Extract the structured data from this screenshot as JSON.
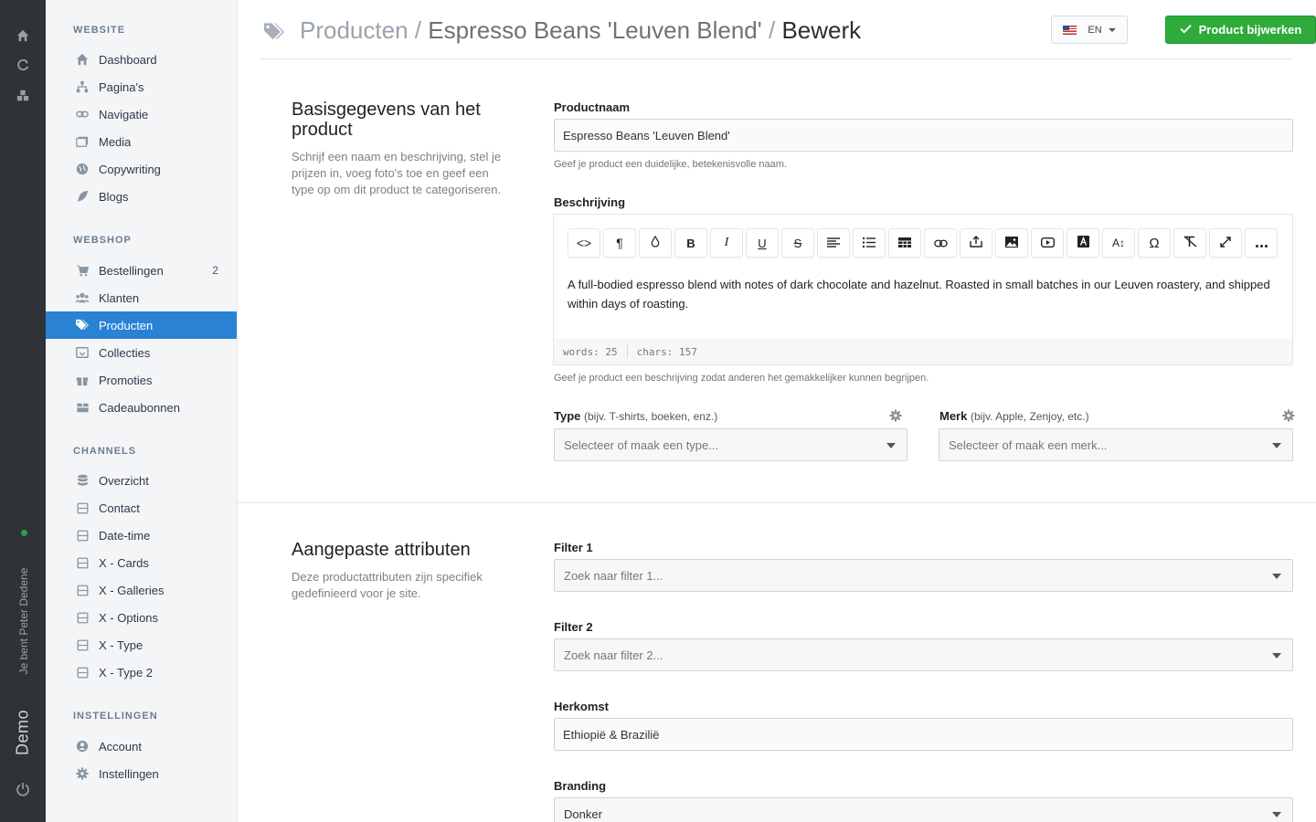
{
  "rail": {
    "user_text": "Je bent Peter Dedene",
    "brand": "Demo",
    "status_color": "#2e9e4f"
  },
  "sidebar": {
    "sections": [
      {
        "title": "WEBSITE",
        "items": [
          {
            "label": "Dashboard",
            "icon": "home-icon"
          },
          {
            "label": "Pagina's",
            "icon": "sitemap-icon"
          },
          {
            "label": "Navigatie",
            "icon": "link-icon"
          },
          {
            "label": "Media",
            "icon": "images-icon"
          },
          {
            "label": "Copywriting",
            "icon": "globe-icon"
          },
          {
            "label": "Blogs",
            "icon": "feather-icon"
          }
        ]
      },
      {
        "title": "WEBSHOP",
        "items": [
          {
            "label": "Bestellingen",
            "icon": "cart-icon",
            "badge": "2"
          },
          {
            "label": "Klanten",
            "icon": "users-icon"
          },
          {
            "label": "Producten",
            "icon": "tags-icon",
            "active": true
          },
          {
            "label": "Collecties",
            "icon": "archive-icon"
          },
          {
            "label": "Promoties",
            "icon": "gift-icon"
          },
          {
            "label": "Cadeaubonnen",
            "icon": "gift-card-icon"
          }
        ]
      },
      {
        "title": "CHANNELS",
        "items": [
          {
            "label": "Overzicht",
            "icon": "database-icon"
          },
          {
            "label": "Contact",
            "icon": "box-icon"
          },
          {
            "label": "Date-time",
            "icon": "box-icon"
          },
          {
            "label": "X - Cards",
            "icon": "box-icon"
          },
          {
            "label": "X - Galleries",
            "icon": "box-icon"
          },
          {
            "label": "X - Options",
            "icon": "box-icon"
          },
          {
            "label": "X - Type",
            "icon": "box-icon"
          },
          {
            "label": "X - Type 2",
            "icon": "box-icon"
          }
        ]
      },
      {
        "title": "INSTELLINGEN",
        "items": [
          {
            "label": "Account",
            "icon": "user-circle-icon"
          },
          {
            "label": "Instellingen",
            "icon": "gear-icon"
          }
        ]
      }
    ]
  },
  "header": {
    "crumb_root": "Producten",
    "crumb_sep": "/",
    "crumb_product": "Espresso Beans 'Leuven Blend'",
    "crumb_current": "Bewerk",
    "lang": "EN",
    "save_label": "Product bijwerken",
    "save_color": "#2eab3b"
  },
  "basic": {
    "heading": "Basisgegevens van het product",
    "description": "Schrijf een naam en beschrijving, stel je prijzen in, voeg foto's toe en geef een type op om dit product te categoriseren.",
    "name_label": "Productnaam",
    "name_value": "Espresso Beans 'Leuven Blend'",
    "name_help": "Geef je product een duidelijke, betekenisvolle naam.",
    "desc_label": "Beschrijving",
    "desc_text": "A full-bodied espresso blend with notes of dark chocolate and hazelnut. Roasted in small batches in our Leuven roastery, and shipped within days of roasting.",
    "words": "words: 25",
    "chars": "chars: 157",
    "desc_help": "Geef je product een beschrijving zodat anderen het gemakkelijker kunnen begrijpen.",
    "type_label": "Type",
    "type_hint": "(bijv. T-shirts, boeken, enz.)",
    "type_placeholder": "Selecteer of maak een type...",
    "brand_label": "Merk",
    "brand_hint": "(bijv. Apple, Zenjoy, etc.)",
    "brand_placeholder": "Selecteer of maak een merk..."
  },
  "custom": {
    "heading": "Aangepaste attributen",
    "description": "Deze productattributen zijn specifiek gedefinieerd voor je site.",
    "filter1_label": "Filter 1",
    "filter1_placeholder": "Zoek naar filter 1...",
    "filter2_label": "Filter 2",
    "filter2_placeholder": "Zoek naar filter 2...",
    "origin_label": "Herkomst",
    "origin_value": "Ethiopië & Brazilië",
    "branding_label": "Branding",
    "branding_value": "Donker"
  }
}
